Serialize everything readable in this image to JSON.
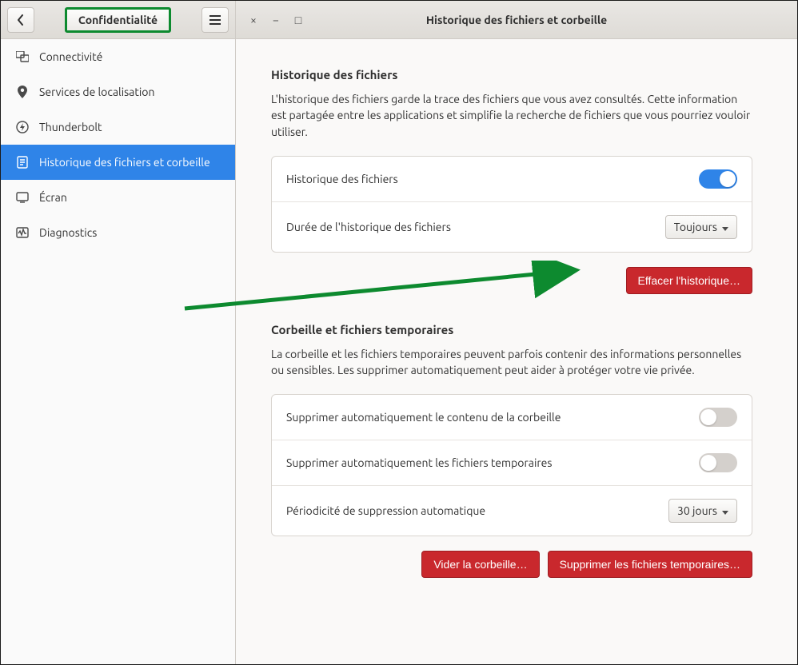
{
  "header": {
    "left_title": "Confidentialité",
    "right_title": "Historique des fichiers et corbeille"
  },
  "sidebar": {
    "items": [
      {
        "icon": "network-icon",
        "label": "Connectivité"
      },
      {
        "icon": "location-icon",
        "label": "Services de localisation"
      },
      {
        "icon": "thunderbolt-icon",
        "label": "Thunderbolt"
      },
      {
        "icon": "file-history-icon",
        "label": "Historique des fichiers et corbeille",
        "active": true
      },
      {
        "icon": "screen-icon",
        "label": "Écran"
      },
      {
        "icon": "diagnostics-icon",
        "label": "Diagnostics"
      }
    ]
  },
  "file_history": {
    "title": "Historique des fichiers",
    "desc": "L'historique des fichiers garde la trace des fichiers que vous avez consultés. Cette information est partagée entre les applications et simplifie la recherche de fichiers que vous pourriez vouloir utiliser.",
    "row_toggle_label": "Historique des fichiers",
    "toggle_on": true,
    "row_duration_label": "Durée de l'historique des fichiers",
    "duration_value": "Toujours",
    "clear_btn": "Effacer l'historique…"
  },
  "trash": {
    "title": "Corbeille et fichiers temporaires",
    "desc": "La corbeille et les fichiers temporaires peuvent parfois contenir des informations personnelles ou sensibles. Les supprimer automatiquement peut aider à protéger votre vie privée.",
    "row_trash_label": "Supprimer automatiquement le contenu de la corbeille",
    "trash_toggle_on": false,
    "row_tmp_label": "Supprimer automatiquement les fichiers temporaires",
    "tmp_toggle_on": false,
    "row_period_label": "Périodicité de suppression automatique",
    "period_value": "30 jours",
    "empty_trash_btn": "Vider la corbeille…",
    "delete_tmp_btn": "Supprimer les fichiers temporaires…"
  },
  "annotation": {
    "type": "arrow",
    "color": "#0d8a2f"
  }
}
